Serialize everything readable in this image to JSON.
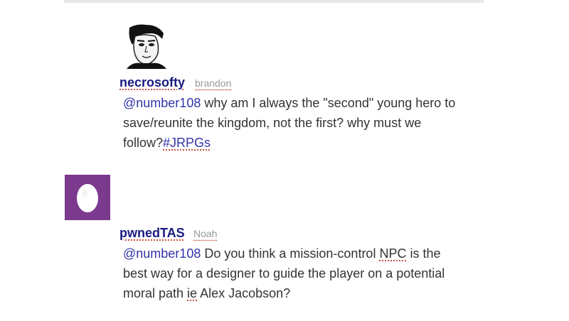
{
  "tweets": [
    {
      "username": "necrosofty",
      "realname": "brandon",
      "mention": "@number108",
      "text_line1": " why am I always the \"second\" young hero to",
      "text_line2": "save/reunite the kingdom, not the first? why must we",
      "text_line3_prefix": "follow?",
      "hashtag": "#JRPGs"
    },
    {
      "username": "pwnedTAS",
      "realname": "Noah",
      "mention": "@number108",
      "text_line1_a": " Do you think a mission-control ",
      "text_line1_npc": "NPC",
      "text_line1_b": " is the",
      "text_line2": "best way for a designer to guide the player on a potential",
      "text_line3_a": "moral path ",
      "text_line3_ie": "ie",
      "text_line3_b": " Alex Jacobson?"
    }
  ],
  "colors": {
    "username": "#1a1a80",
    "link": "#3333aa",
    "egg_background": "#7b3a8e"
  },
  "icons": [
    "user-photo-avatar",
    "default-egg-avatar"
  ]
}
